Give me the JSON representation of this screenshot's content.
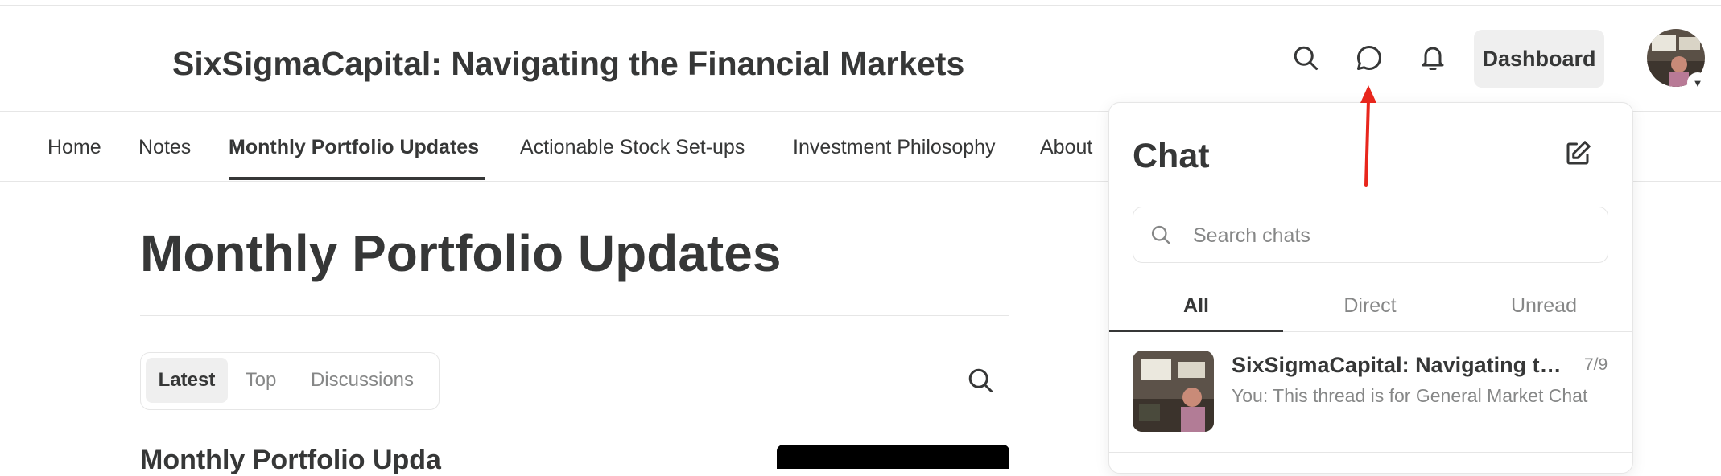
{
  "header": {
    "title": "SixSigmaCapital: Navigating the Financial Markets",
    "dashboard_label": "Dashboard",
    "icons": [
      "search-icon",
      "chat-icon",
      "bell-icon"
    ]
  },
  "nav": {
    "items": [
      {
        "label": "Home"
      },
      {
        "label": "Notes"
      },
      {
        "label": "Monthly Portfolio Updates",
        "active": true
      },
      {
        "label": "Actionable Stock Set-ups"
      },
      {
        "label": "Investment Philosophy"
      },
      {
        "label": "About"
      }
    ]
  },
  "main": {
    "page_title": "Monthly Portfolio Updates",
    "filters": [
      "Latest",
      "Top",
      "Discussions"
    ],
    "active_filter": "Latest",
    "post_title_partial": "Monthly Portfolio Upda"
  },
  "chat": {
    "title": "Chat",
    "search_placeholder": "Search chats",
    "tabs": [
      "All",
      "Direct",
      "Unread"
    ],
    "active_tab": "All",
    "threads": [
      {
        "name": "SixSigmaCapital: Navigating the Financial Markets",
        "date": "7/9",
        "preview": "You: This thread is for General Market Chat"
      }
    ]
  },
  "annotation": {
    "color": "#e8261c",
    "icon": "arrow-up-icon"
  },
  "colors": {
    "text": "#363737",
    "muted": "#868787",
    "border": "#e6e6e6",
    "button_bg": "#efefef"
  }
}
